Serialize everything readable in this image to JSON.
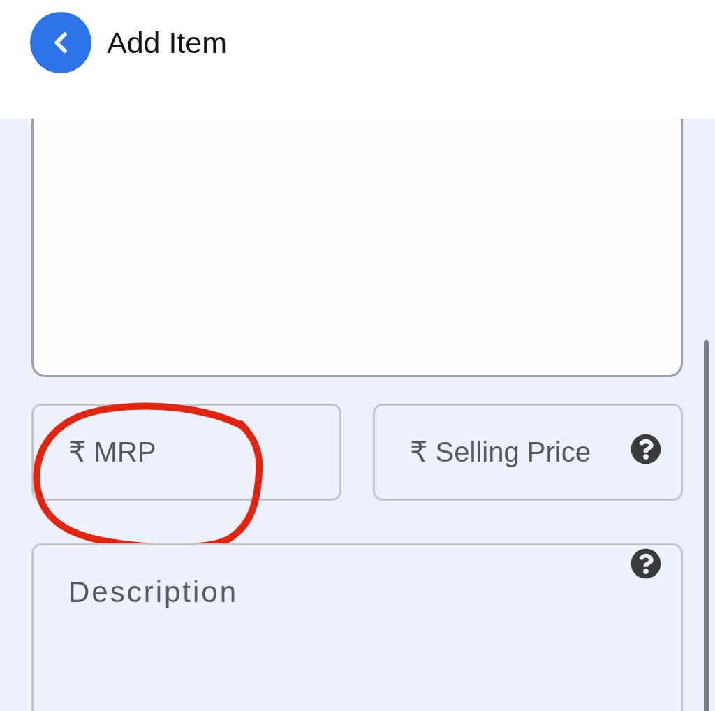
{
  "header": {
    "title": "Add Item"
  },
  "price_fields": [
    {
      "placeholder": "₹ MRP",
      "has_help": false,
      "annotated": true
    },
    {
      "placeholder": "₹ Selling Price",
      "has_help": true,
      "annotated": false
    }
  ],
  "description": {
    "placeholder": "Description",
    "has_help": true
  }
}
